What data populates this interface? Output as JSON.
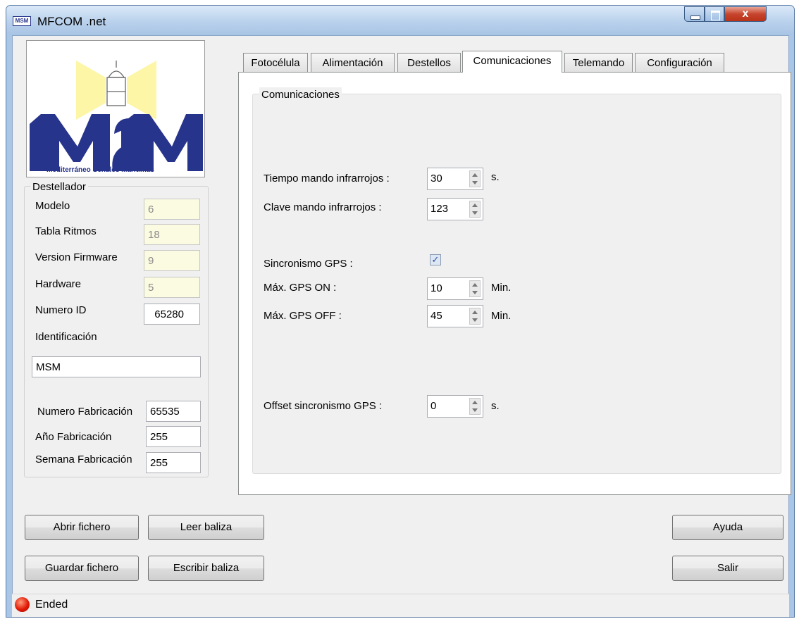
{
  "window": {
    "title": "MFCOM .net",
    "icon_text": "MSM",
    "close_glyph": "x"
  },
  "logo": {
    "brand_text": "MSM",
    "caption": "Mediterráneo Señales Maritimas"
  },
  "destellador": {
    "group_label": "Destellador",
    "fields": [
      {
        "label": "Modelo",
        "value": "6"
      },
      {
        "label": "Tabla Ritmos",
        "value": "18"
      },
      {
        "label": "Version Firmware",
        "value": "9"
      },
      {
        "label": "Hardware",
        "value": "5"
      },
      {
        "label": "Numero ID",
        "value": "65280"
      }
    ],
    "identificacion_label": "Identificación",
    "identificacion_value": "MSM",
    "fab_fields": [
      {
        "label": "Numero Fabricación",
        "value": "65535"
      },
      {
        "label": "Año Fabricación",
        "value": "255"
      },
      {
        "label": "Semana Fabricación",
        "value": "255"
      }
    ]
  },
  "tabs": [
    "Fotocélula",
    "Alimentación",
    "Destellos",
    "Comunicaciones",
    "Telemando",
    "Configuración"
  ],
  "active_tab": "Comunicaciones",
  "comunicaciones": {
    "group_label": "Comunicaciones",
    "tiempo_ir": {
      "label": "Tiempo mando infrarrojos :",
      "value": "30",
      "unit": "s."
    },
    "clave_ir": {
      "label": "Clave mando infrarrojos :",
      "value": "123"
    },
    "sincronismo_gps": {
      "label": "Sincronismo GPS :",
      "checked": true
    },
    "max_gps_on": {
      "label": "Máx. GPS ON :",
      "value": "10",
      "unit": "Min."
    },
    "max_gps_off": {
      "label": "Máx. GPS OFF :",
      "value": "45",
      "unit": "Min."
    },
    "offset_gps": {
      "label": "Offset sincronismo GPS :",
      "value": "0",
      "unit": "s."
    }
  },
  "buttons": {
    "abrir": "Abrir fichero",
    "leer": "Leer baliza",
    "guardar": "Guardar fichero",
    "escribir": "Escribir baliza",
    "ayuda": "Ayuda",
    "salir": "Salir"
  },
  "status": {
    "text": "Ended",
    "led_color": "#e21a06"
  }
}
